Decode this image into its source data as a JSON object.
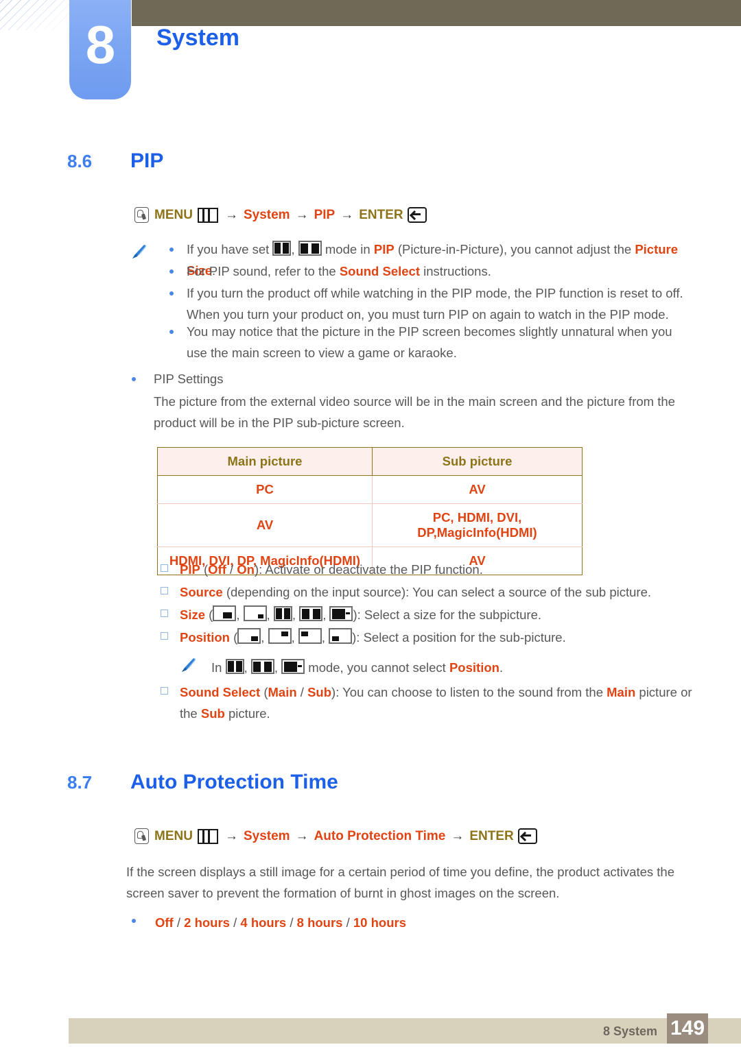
{
  "header": {
    "chapter_number": "8",
    "chapter_title": "System"
  },
  "sections": [
    {
      "number": "8.6",
      "title": "PIP",
      "menu_path": {
        "finger_icon": "finger-press-icon",
        "menu_label": "MENU",
        "menu_icon": "menu-grid-icon",
        "arrow": "→",
        "items": [
          "System",
          "PIP"
        ],
        "enter_label": "ENTER",
        "enter_icon": "enter-key-icon"
      }
    },
    {
      "number": "8.7",
      "title": "Auto Protection Time",
      "menu_path": {
        "finger_icon": "finger-press-icon",
        "menu_label": "MENU",
        "menu_icon": "menu-grid-icon",
        "arrow": "→",
        "items": [
          "System",
          "Auto Protection Time"
        ],
        "enter_label": "ENTER",
        "enter_icon": "enter-key-icon"
      }
    }
  ],
  "notes": {
    "icon": "note-pen-icon",
    "bullets": [
      {
        "pre": "If you have set ",
        "icons": [
          "mode-double-icon",
          "mode-wide-double-icon"
        ],
        "mid": " mode in ",
        "kw1": "PIP",
        "post": " (Picture-in-Picture), you cannot adjust the ",
        "kw2": "Picture Size",
        "end": "."
      },
      {
        "pre": "For PIP sound, refer to the ",
        "kw1": "Sound Select",
        "post": " instructions."
      },
      {
        "text": "If you turn the product off while watching in the PIP mode, the PIP function is reset to off. When you turn your product on, you must turn PIP on again to watch in the PIP mode."
      },
      {
        "text": "You may notice that the picture in the PIP screen becomes slightly unnatural when you use the main screen to view a game or karaoke."
      }
    ]
  },
  "pip_settings": {
    "heading": "PIP Settings",
    "description_line1": "The picture from the external video source will be in the main screen and the picture from the",
    "description_line2": "product will be in the PIP sub-picture screen.",
    "table": {
      "headers": [
        "Main picture",
        "Sub picture"
      ],
      "rows": [
        [
          "PC",
          "AV"
        ],
        [
          "AV",
          "PC, HDMI, DVI, DP,MagicInfo(HDMI)"
        ],
        [
          "HDMI, DVI, DP, MagicInfo(HDMI)",
          "AV"
        ]
      ]
    }
  },
  "options": {
    "pip": {
      "label": "PIP",
      "values": [
        "Off",
        "On"
      ],
      "separator": " / ",
      "description": "): Activate or deactivate the PIP function.",
      "open": " ("
    },
    "source": {
      "label": "Source",
      "description": " (depending on the input source): You can select a source of the sub picture."
    },
    "size": {
      "label": "Size",
      "open": " (",
      "icons": [
        "size-small-bottom-icon",
        "size-tiny-bottom-right-icon",
        "mode-double-icon",
        "mode-wide-double-icon",
        "mode-dash-icon"
      ],
      "description": "): Select a size for the subpicture."
    },
    "position": {
      "label": "Position",
      "open": " (",
      "icons": [
        "position-bottom-right-icon",
        "position-top-right-icon",
        "position-top-left-icon",
        "position-bottom-left-icon"
      ],
      "description": "): Select a position for the sub-picture."
    },
    "position_note": {
      "icon": "note-pen-icon",
      "pre": "In ",
      "icons": [
        "mode-double-icon",
        "mode-wide-double-icon",
        "mode-dash-icon"
      ],
      "mid": " mode, you cannot select ",
      "kw": "Position",
      "end": "."
    },
    "sound_select": {
      "label": "Sound Select",
      "open": " (",
      "values": [
        "Main",
        "Sub"
      ],
      "separator": " / ",
      "mid": "): You can choose to listen to the sound from the ",
      "kw1": "Main",
      "mid2": " picture or the ",
      "kw2": "Sub",
      "end": " picture."
    }
  },
  "auto_protection": {
    "body_line1": "If the screen displays a still image for a certain period of time you define, the product activates the screen",
    "body_line2": "saver to prevent the formation of burnt in ghost images on the screen.",
    "options": [
      "Off",
      "2 hours",
      "4 hours",
      "8 hours",
      "10 hours"
    ],
    "separator": " / "
  },
  "footer": {
    "label": "8 System",
    "page": "149"
  },
  "colors": {
    "accent_blue": "#1c5fe8",
    "badge_blue": "#79a4f2",
    "keyword_red": "#e04413",
    "olive": "#8d7418",
    "header_bar": "#6e6a56",
    "footer_bar": "#d8d2bd",
    "page_box": "#9a8d80"
  }
}
